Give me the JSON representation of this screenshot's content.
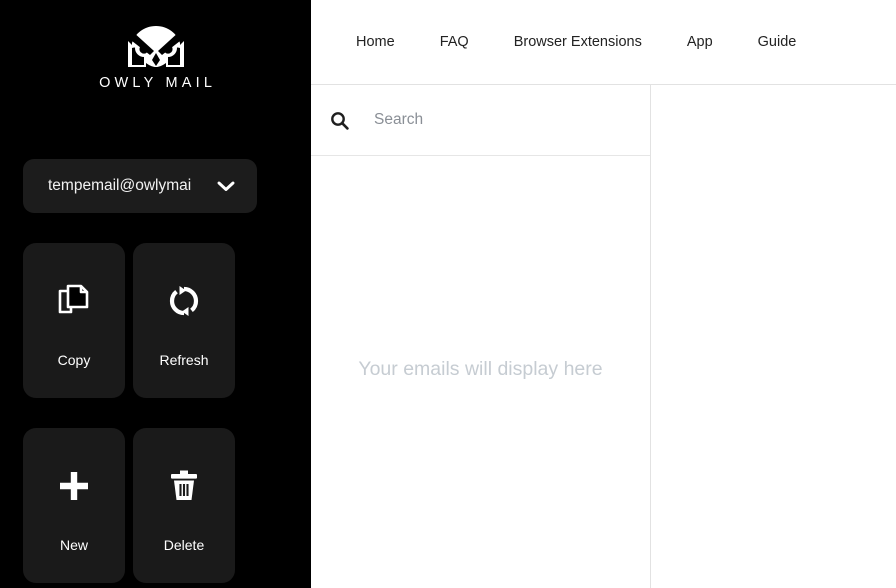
{
  "brand": {
    "logo_icon": "owl-icon",
    "wordmark": "OWLY MAIL"
  },
  "sidebar": {
    "account": {
      "email": "tempemail@owlymai",
      "dropdown_icon": "chevron-down-icon"
    },
    "actions": [
      {
        "label": "Copy",
        "icon": "copy-icon"
      },
      {
        "label": "Refresh",
        "icon": "refresh-icon"
      },
      {
        "label": "New",
        "icon": "plus-icon"
      },
      {
        "label": "Delete",
        "icon": "trash-icon"
      }
    ]
  },
  "header": {
    "nav": [
      {
        "label": "Home"
      },
      {
        "label": "FAQ"
      },
      {
        "label": "Browser Extensions"
      },
      {
        "label": "App"
      },
      {
        "label": "Guide"
      }
    ]
  },
  "search": {
    "icon": "search-icon",
    "value": "",
    "placeholder": "Search"
  },
  "inbox": {
    "empty_message": "Your emails will display here"
  },
  "colors": {
    "sidebar_bg": "#000000",
    "tile_bg": "#1a1a1a",
    "pill_bg": "#1c1c1c",
    "main_bg": "#ffffff",
    "border": "#e2e2e2",
    "empty_text": "#c6ccd2",
    "placeholder_text": "#8a8f96",
    "nav_text": "#222222"
  }
}
